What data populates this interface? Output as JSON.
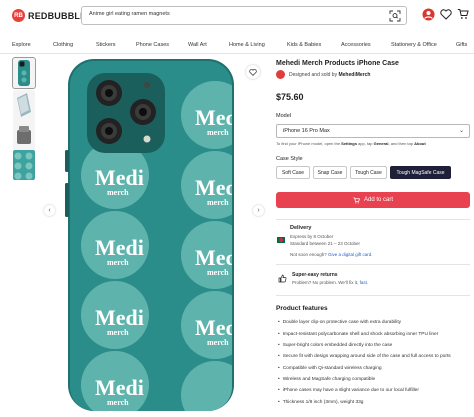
{
  "header": {
    "logo_mark": "RB",
    "logo_text": "REDBUBBLE",
    "search_value": "Anime girl eating ramen magnets"
  },
  "nav": {
    "items": [
      "Explore",
      "Clothing",
      "Stickers",
      "Phone Cases",
      "Wall Art",
      "Home & Living",
      "Kids & Babies",
      "Accessories",
      "Stationery & Office",
      "Gifts"
    ]
  },
  "gallery": {
    "case_text_line1": "Medi",
    "case_text_line2": "merch",
    "case_color": "#2a8d8a",
    "circle_color": "#5fb3ad",
    "prev_arrow": "‹",
    "next_arrow": "›"
  },
  "product": {
    "title": "Mehedi Merch Products iPhone Case",
    "designer_prefix": "Designed and sold by ",
    "designer_name": "MehediMerch",
    "price": "$75.60",
    "model_label": "Model",
    "model_value": "iPhone 16 Pro Max",
    "model_hint_prefix": "To find your iPhone model, open the ",
    "model_hint_settings": "Settings",
    "model_hint_mid1": " app, tap ",
    "model_hint_general": "General",
    "model_hint_mid2": ", and then tap ",
    "model_hint_about": "About",
    "case_style_label": "Case Style",
    "case_styles": [
      "Soft Case",
      "Snap Case",
      "Tough Case",
      "Tough MagSafe Case"
    ],
    "selected_case_style": "Tough MagSafe Case",
    "add_to_cart": "Add to cart"
  },
  "delivery": {
    "title": "Delivery",
    "express": "Express by 8 October",
    "standard": "Standard between 21 – 23 October",
    "not_soon_prefix": "Not soon enough? ",
    "not_soon_link": "Give a digital gift card."
  },
  "returns": {
    "title": "Super-easy returns",
    "text_prefix": "Problem? No problem. We'll fix it, ",
    "text_link": "fast."
  },
  "features": {
    "title": "Product features",
    "items": [
      "Double layer clip-on protective case with extra durability",
      "Impact-resistant polycarbonate shell and shock absorbing inner TPU liner",
      "Super-bright colors embedded directly into the case",
      "Secure fit with design wrapping around side of the case and full access to ports",
      "Compatible with Qi-standard wireless charging",
      "Wireless and MagSafe charging compatible",
      "iPhone cases may have a slight variance due to our local fulfiller",
      "Thickness 1/8 inch (3mm), weight 33g"
    ]
  },
  "colors": {
    "accent": "#e8414f",
    "selected_style_bg": "#1f1f3a",
    "link": "#2a62c9"
  }
}
